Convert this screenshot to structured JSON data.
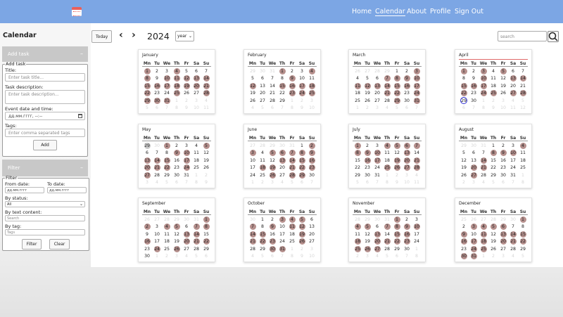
{
  "nav": {
    "home": "Home",
    "calendar": "Calendar",
    "about": "About",
    "profile": "Profile",
    "signout": "Sign Out"
  },
  "sidebar": {
    "title": "Calendar",
    "add_task": {
      "header": "Add task",
      "chevron": "–",
      "legend": "Add task",
      "title_label": "Title:",
      "title_placeholder": "Enter task title...",
      "desc_label": "Task description:",
      "desc_placeholder": "Enter task description...",
      "date_label": "Event date and time:",
      "date_value": "дд.мм.гггг, --:--",
      "tags_label": "Tags:",
      "tags_placeholder": "Enter comma separated tags",
      "add_button": "Add"
    },
    "filter": {
      "header": "Filter",
      "chevron": "–",
      "legend": "Filter",
      "from_label": "From date:",
      "to_label": "To date:",
      "from_value": "дд.мм.гггг",
      "to_value": "дд.мм.гггг",
      "status_label": "By status:",
      "status_value": "All",
      "text_label": "By text content:",
      "text_placeholder": "Search",
      "tag_label": "By tag:",
      "tag_placeholder": "Tags",
      "filter_button": "Filter",
      "clear_button": "Clear"
    }
  },
  "controls": {
    "today": "Today",
    "prev": "‹",
    "next": "›",
    "year": "2024",
    "view": "year",
    "search_placeholder": "search"
  },
  "weekdays": [
    "Mn",
    "Tu",
    "We",
    "Th",
    "Fr",
    "Sa",
    "Su"
  ],
  "months": [
    {
      "name": "January",
      "offset": 0,
      "days": 31,
      "prev_days": 31,
      "events": [
        1,
        4,
        8,
        10,
        11,
        12,
        13,
        14,
        15,
        16,
        17,
        18,
        19,
        20,
        21,
        22,
        25,
        28,
        29,
        30,
        31
      ],
      "out_events": []
    },
    {
      "name": "February",
      "offset": 3,
      "days": 29,
      "prev_days": 31,
      "events": [
        1,
        4,
        9,
        12,
        15,
        16,
        17,
        18,
        23,
        24,
        25
      ],
      "out_events": []
    },
    {
      "name": "March",
      "offset": 4,
      "days": 31,
      "prev_days": 29,
      "events": [
        3,
        7,
        8,
        9,
        10,
        11,
        12,
        13,
        14,
        15,
        16,
        17,
        21,
        22,
        24,
        29,
        31
      ],
      "out_events": []
    },
    {
      "name": "April",
      "offset": 0,
      "days": 30,
      "prev_days": 31,
      "events": [
        1,
        3,
        5,
        10,
        13,
        14,
        15,
        16,
        17,
        22,
        24,
        25,
        27,
        28
      ],
      "out_events": [],
      "today": 29,
      "current": true
    },
    {
      "name": "May",
      "offset": 2,
      "days": 31,
      "prev_days": 30,
      "events": [
        1,
        5,
        9,
        10,
        13,
        14,
        15,
        17,
        20,
        21,
        22,
        24,
        27
      ],
      "out_events": [
        29
      ]
    },
    {
      "name": "June",
      "offset": 5,
      "days": 30,
      "prev_days": 31,
      "events": [
        2,
        3,
        5,
        6,
        7,
        8,
        9,
        13,
        14,
        15,
        16,
        18,
        19,
        21,
        22,
        23,
        26,
        28,
        29
      ],
      "out_events": []
    },
    {
      "name": "July",
      "offset": 0,
      "days": 31,
      "prev_days": 30,
      "events": [
        1,
        4,
        5,
        6,
        7,
        8,
        9,
        10,
        13,
        16,
        17,
        19,
        20,
        21,
        25,
        26,
        27,
        28
      ],
      "out_events": []
    },
    {
      "name": "August",
      "offset": 3,
      "days": 31,
      "prev_days": 31,
      "events": [
        4,
        8,
        9,
        10,
        14,
        20,
        21,
        27
      ],
      "out_events": []
    },
    {
      "name": "September",
      "offset": 6,
      "days": 30,
      "prev_days": 31,
      "events": [
        1,
        2,
        4,
        5,
        7,
        8,
        13,
        14,
        16,
        20,
        21,
        22,
        24,
        26
      ],
      "out_events": []
    },
    {
      "name": "October",
      "offset": 1,
      "days": 31,
      "prev_days": 30,
      "events": [
        3,
        4,
        5,
        7,
        9,
        11,
        12,
        14,
        15,
        19,
        21,
        22,
        23,
        26,
        30,
        31
      ],
      "out_events": []
    },
    {
      "name": "November",
      "offset": 4,
      "days": 30,
      "prev_days": 31,
      "events": [
        1,
        4,
        5,
        7,
        8,
        9,
        10,
        13,
        15,
        16,
        18,
        20,
        21,
        22,
        23,
        25,
        26,
        27
      ],
      "out_events": []
    },
    {
      "name": "December",
      "offset": 6,
      "days": 31,
      "prev_days": 30,
      "events": [
        1,
        3,
        4,
        5,
        6,
        9,
        11,
        13,
        14,
        15,
        16,
        17,
        18,
        20,
        21,
        22,
        24,
        25,
        30,
        31
      ],
      "out_events": []
    }
  ]
}
